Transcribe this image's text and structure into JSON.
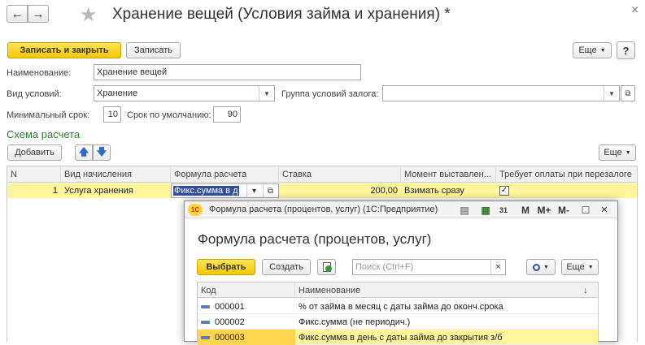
{
  "nav": {
    "back": "←",
    "forward": "→",
    "favorite": "★"
  },
  "window": {
    "title": "Хранение вещей (Условия займа и хранения) *",
    "close": "×"
  },
  "toolbar": {
    "save_close": "Записать и закрыть",
    "save": "Записать",
    "more": "Еще",
    "help": "?"
  },
  "form": {
    "name_label": "Наименование:",
    "name_value": "Хранение вещей",
    "kind_label": "Вид условий:",
    "kind_value": "Хранение",
    "group_label": "Группа условий залога:",
    "group_value": "",
    "min_term_label": "Минимальный срок:",
    "min_term_value": "10",
    "default_term_label": "Срок по умолчанию:",
    "default_term_value": "90"
  },
  "schema": {
    "title": "Схема расчета",
    "add": "Добавить",
    "more": "Еще",
    "columns": [
      "N",
      "Вид начисления",
      "Формула расчета",
      "Ставка",
      "Момент выставлен...",
      "Требует оплаты при перезалоге"
    ],
    "row": {
      "n": "1",
      "kind": "Услуга хранения",
      "formula": "Фикс.сумма в д",
      "rate": "200,00",
      "moment": "Взимать сразу",
      "requires": "✓"
    }
  },
  "popup": {
    "app_title": "Формула расчета (процентов, услуг)  (1С:Предприятие)",
    "logo": "1С",
    "ctrl_m": "M",
    "ctrl_mplus": "M+",
    "ctrl_mminus": "M-",
    "ctrl_max": "☐",
    "ctrl_close": "×",
    "heading": "Формула расчета (процентов, услуг)",
    "select": "Выбрать",
    "create": "Создать",
    "search_placeholder": "Поиск (Ctrl+F)",
    "more": "Еще",
    "columns": [
      "Код",
      "Наименование"
    ],
    "rows": [
      {
        "code": "000001",
        "name": "% от займа в месяц с даты займа до оконч.срока"
      },
      {
        "code": "000002",
        "name": "Фикс.сумма (не периодич.)"
      },
      {
        "code": "000003",
        "name": "Фикс.сумма в день с даты займа до закрытия з/б"
      }
    ]
  }
}
